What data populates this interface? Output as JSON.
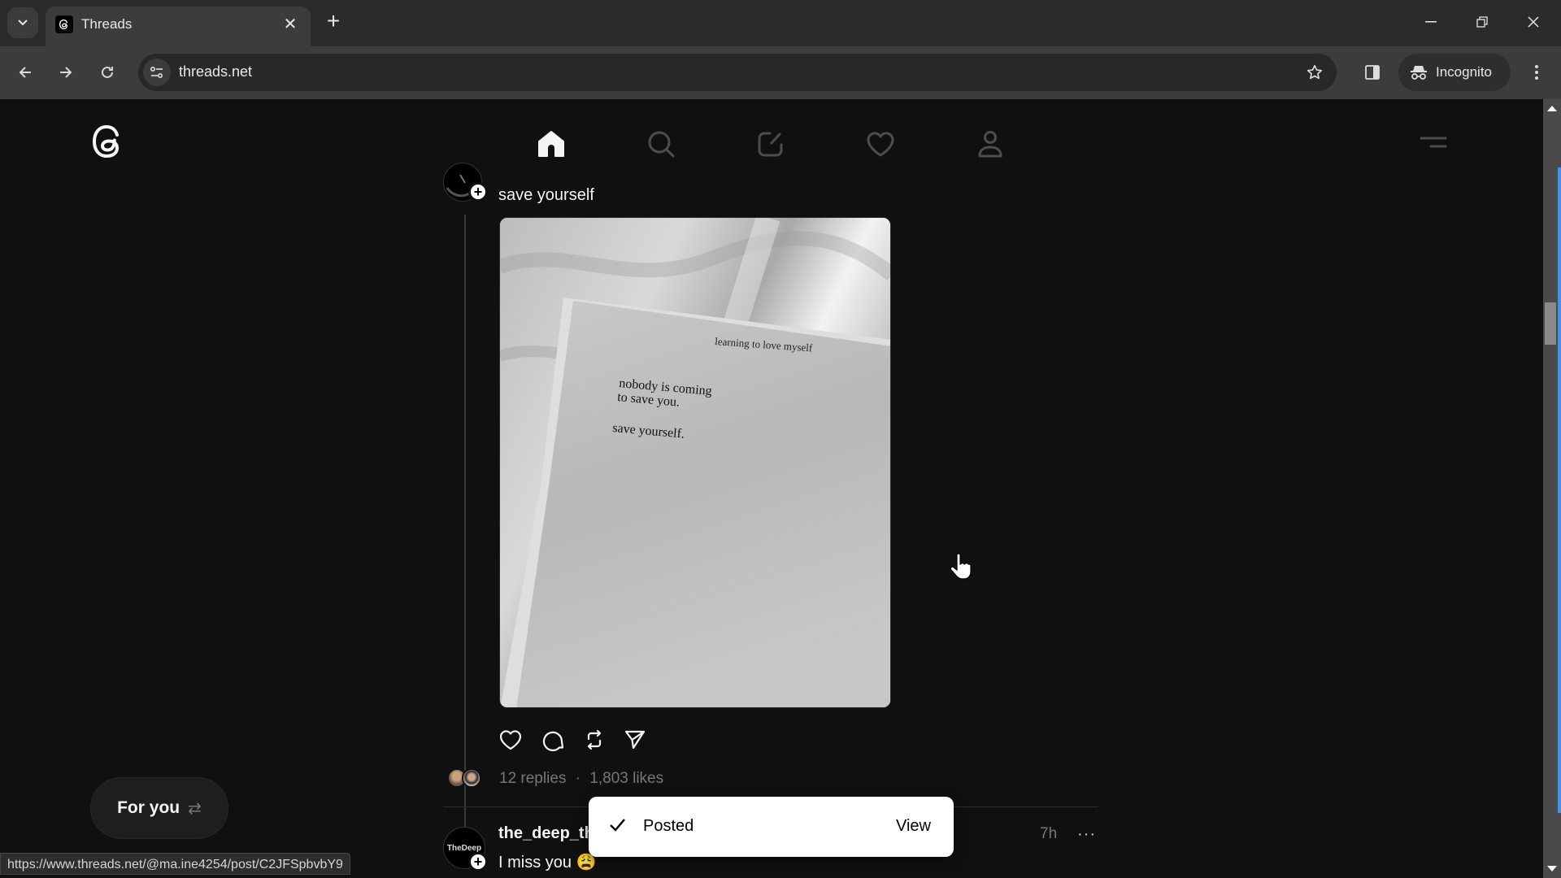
{
  "browser": {
    "tab_title": "Threads",
    "url": "threads.net",
    "incognito_label": "Incognito",
    "status_url": "https://www.threads.net/@ma.ine4254/post/C2JFSpbvbY9"
  },
  "nav": {
    "items": [
      {
        "name": "home",
        "icon": "home-icon",
        "active": true
      },
      {
        "name": "search",
        "icon": "search-icon",
        "active": false
      },
      {
        "name": "create",
        "icon": "compose-icon",
        "active": false
      },
      {
        "name": "activity",
        "icon": "heart-icon",
        "active": false
      },
      {
        "name": "profile",
        "icon": "user-icon",
        "active": false
      }
    ]
  },
  "post": {
    "text": "save yourself",
    "image_text": {
      "header": "learning to love myself",
      "line1": "nobody is coming",
      "line2": "to save you.",
      "line3": "save yourself."
    },
    "replies": "12 replies",
    "separator": "·",
    "likes": "1,803 likes"
  },
  "next_post": {
    "avatar_text": "TheDeep",
    "username": "the_deep_th",
    "text": "I miss you 😩",
    "time": "7h",
    "more": "···"
  },
  "feed_switch": {
    "label": "For you",
    "icon": "⇄"
  },
  "toast": {
    "message": "Posted",
    "action": "View"
  }
}
